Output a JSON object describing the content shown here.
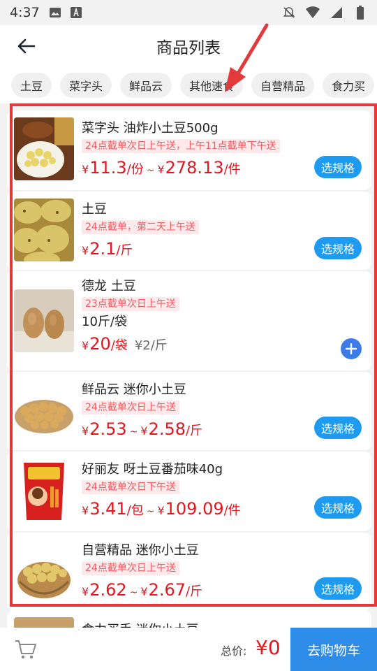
{
  "status_bar": {
    "time": "4:37",
    "left_icons": [
      "image-icon",
      "app-a-icon"
    ],
    "right_icons": [
      "bell-off-icon",
      "wifi-icon",
      "signal-icon",
      "battery-icon"
    ]
  },
  "header": {
    "title": "商品列表",
    "back_icon": "back-arrow-icon"
  },
  "tabs": [
    "土豆",
    "菜字头",
    "鲜品云",
    "其他速食",
    "自营精品",
    "食力买"
  ],
  "products": [
    {
      "title": "菜字头 油炸小土豆500g",
      "tag": "24点截单次日上午送，上午11点截单下午送",
      "price_low": "11.3",
      "unit_low": "/份",
      "price_high": "278.13",
      "unit_high": "/件",
      "button": "选规格"
    },
    {
      "title": "土豆",
      "tag": "24点截单，第二天上午送",
      "price_low": "2.1",
      "unit_low": "/斤",
      "button": "选规格"
    },
    {
      "title": "德龙 土豆",
      "tag": "23点截单次日上午送",
      "spec": "10斤/袋",
      "price_low": "20",
      "unit_low": "/袋",
      "price_extra": "¥2/斤",
      "button_icon": "plus-icon"
    },
    {
      "title": "鲜品云 迷你小土豆",
      "tag": "24点截单次日上午送",
      "price_low": "2.53",
      "unit_low": "",
      "price_high": "2.58",
      "unit_high": "/斤",
      "button": "选规格"
    },
    {
      "title": "好丽友 呀土豆番茄味40g",
      "tag": "24点截单次日下午送",
      "price_low": "3.41",
      "unit_low": "/包",
      "price_high": "109.09",
      "unit_high": "/件",
      "button": "选规格"
    },
    {
      "title": "自营精品 迷你小土豆",
      "tag": "24点截单次日上午送",
      "price_low": "2.62",
      "unit_low": "",
      "price_high": "2.67",
      "unit_high": "/斤",
      "button": "选规格"
    }
  ],
  "peek_title": "食力买手 迷你小土豆",
  "yen": "¥",
  "tilde": "~",
  "bottom": {
    "total_label": "总价:",
    "total_value": "¥0",
    "go_cart": "去购物车",
    "cart_icon": "cart-icon"
  },
  "colors": {
    "price_red": "#e8141d",
    "spec_blue": "#1e9bf0",
    "go_cart_blue": "#2e8de8",
    "highlight_red": "#e23a3a"
  }
}
